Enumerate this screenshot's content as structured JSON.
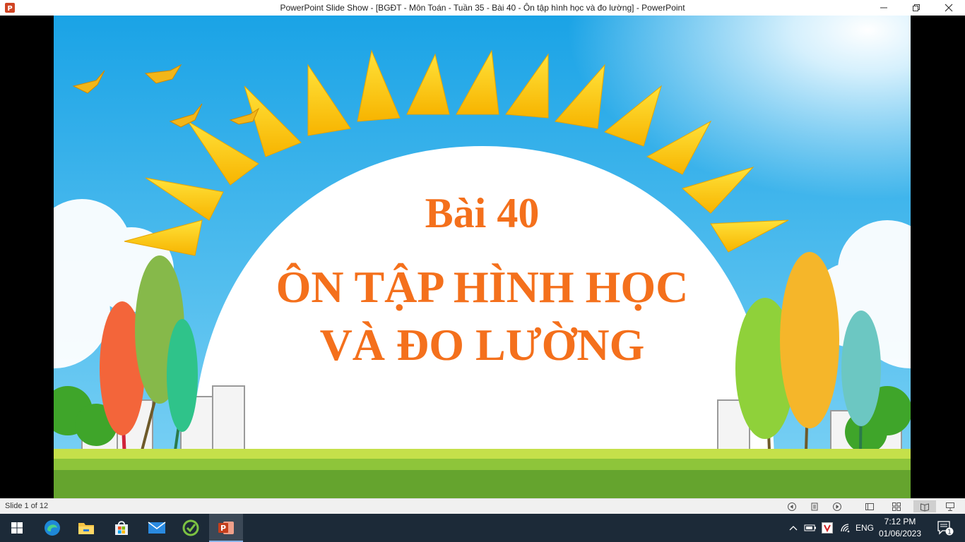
{
  "window": {
    "title": "PowerPoint Slide Show - [BGĐT - Môn Toán - Tuần 35 - Bài 40 - Ôn tập hình học và đo lường] - PowerPoint",
    "app_icon": "powerpoint-icon",
    "controls": [
      "minimize-icon",
      "restore-icon",
      "close-icon"
    ]
  },
  "slide": {
    "lesson": "Bài 40",
    "title_line1": "ÔN TẬP HÌNH HỌC",
    "title_line2": "VÀ ĐO LƯỜNG",
    "accent_color": "#f4701c"
  },
  "statusbar": {
    "slide_count": "Slide 1 of 12",
    "icons": [
      "previous-icon",
      "menu-icon",
      "next-icon",
      "normal-view-icon",
      "slide-sorter-icon",
      "reading-view-icon",
      "slide-show-icon"
    ]
  },
  "taskbar": {
    "apps": [
      "start-icon",
      "edge-icon",
      "file-explorer-icon",
      "microsoft-store-icon",
      "mail-icon",
      "green-app-icon",
      "powerpoint-icon"
    ],
    "language": "ENG",
    "time": "7:12 PM",
    "date": "01/06/2023",
    "notification_count": "1"
  }
}
